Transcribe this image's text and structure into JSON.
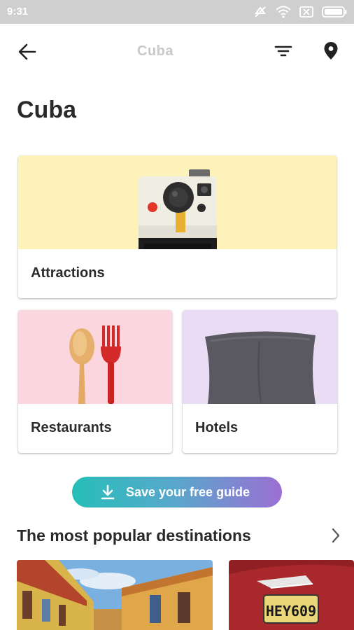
{
  "status_bar": {
    "time": "9:31"
  },
  "app_bar": {
    "title": "Cuba"
  },
  "page": {
    "title": "Cuba"
  },
  "categories": [
    {
      "label": "Attractions"
    },
    {
      "label": "Restaurants"
    },
    {
      "label": "Hotels"
    }
  ],
  "save_button": {
    "label": "Save your free guide"
  },
  "popular": {
    "title": "The most popular destinations",
    "plate_text": "HEY609"
  },
  "colors": {
    "attractions_bg": "#fdf3ba",
    "restaurants_bg": "#fbd6de",
    "hotels_bg": "#eadcf4",
    "gradient_start": "#26bfb8",
    "gradient_end": "#9c6fd3"
  }
}
